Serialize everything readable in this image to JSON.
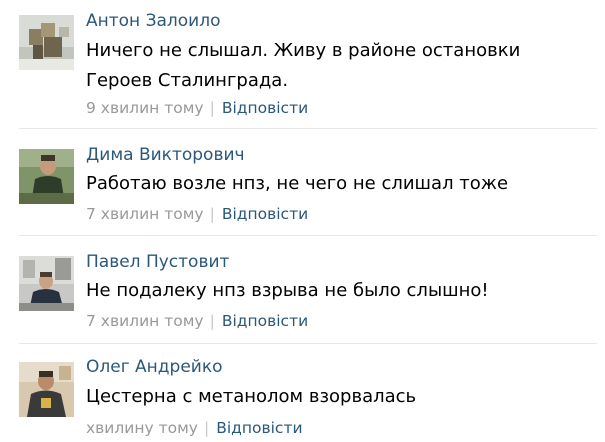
{
  "comments": [
    {
      "author": "Антон Залоило",
      "text": "Ничего не слышал. Живу в районе остановки Героев Сталинграда.",
      "time": "9 хвилин тому",
      "reply_label": "Відповісти",
      "avatar_icon": "user-avatar-photo"
    },
    {
      "author": "Дима Викторович",
      "text": "Работаю возле нпз, не чего не слишал тоже",
      "time": "7 хвилин тому",
      "reply_label": "Відповісти",
      "avatar_icon": "user-avatar-photo"
    },
    {
      "author": "Павел Пустовит",
      "text": "Не подалеку нпз взрыва не было слышно!",
      "time": "7 хвилин тому",
      "reply_label": "Відповісти",
      "avatar_icon": "user-avatar-photo"
    },
    {
      "author": "Олег Андрейко",
      "text": "Цестерна с метанолом взорвалась",
      "time": "хвилину тому",
      "reply_label": "Відповісти",
      "avatar_icon": "user-avatar-photo"
    }
  ],
  "separator": "|",
  "colors": {
    "link": "#2b587a",
    "meta": "#999999",
    "separator": "#c9c9c9",
    "divider": "#e7e8ec",
    "text": "#000000"
  }
}
